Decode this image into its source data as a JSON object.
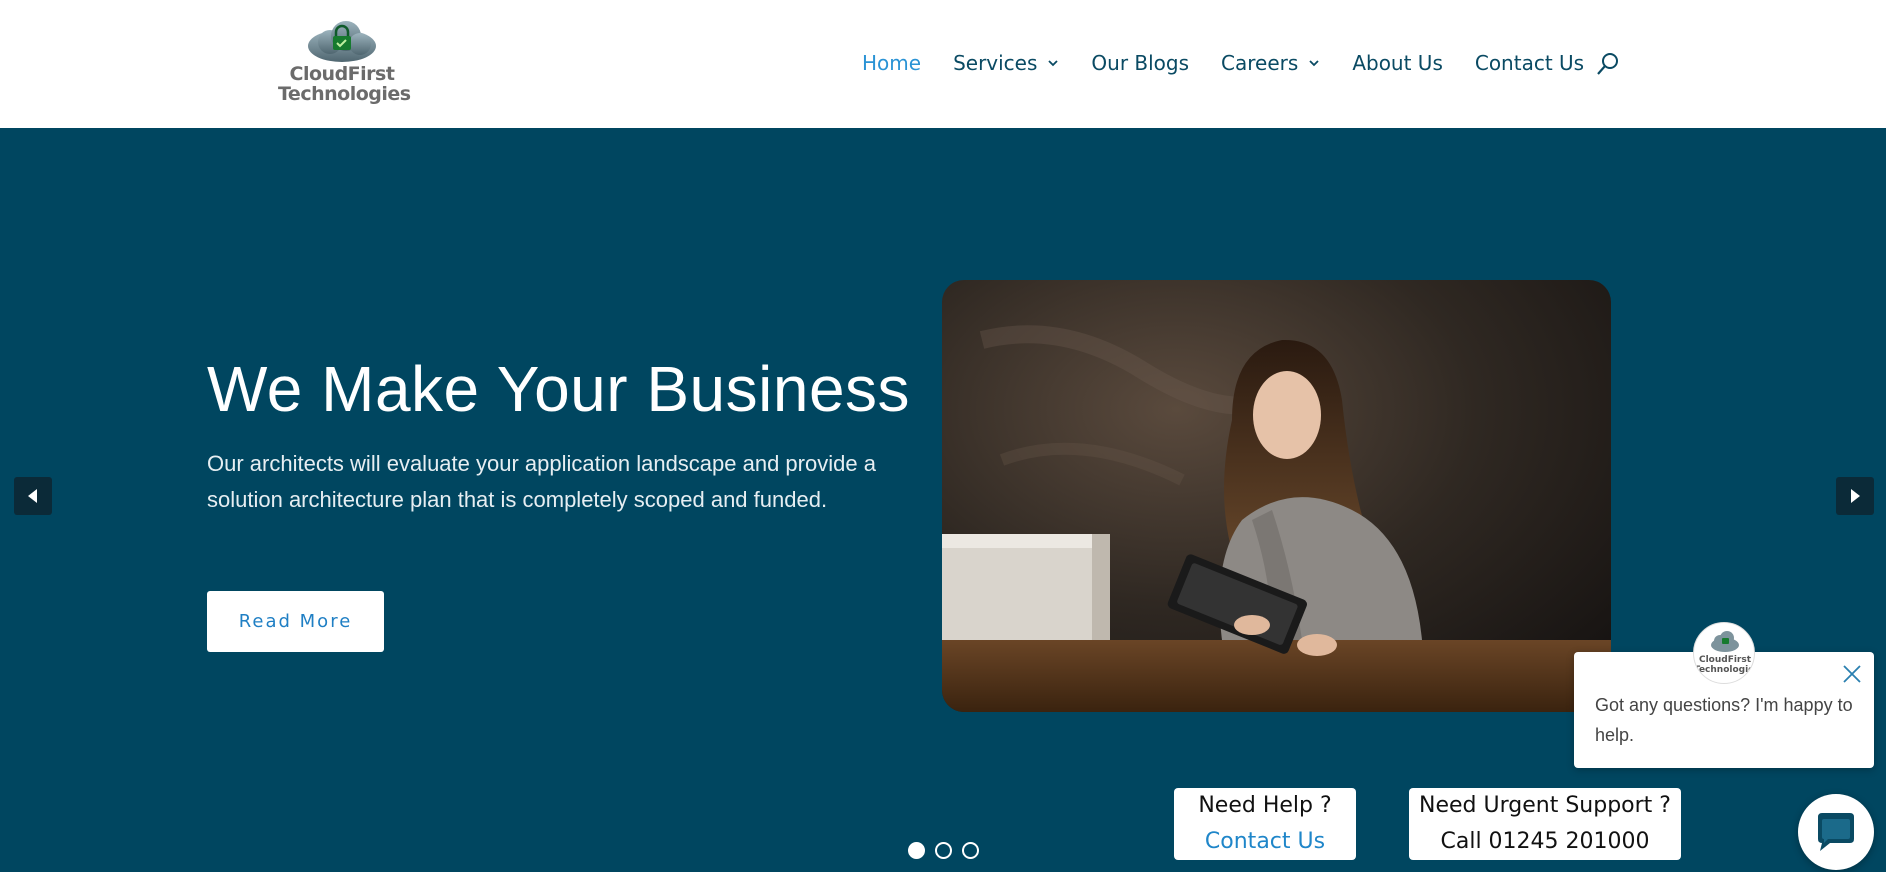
{
  "logo": {
    "line1": "CloudFirst",
    "line2": "Technologies"
  },
  "nav": {
    "items": [
      {
        "label": "Home",
        "active": true,
        "dropdown": false
      },
      {
        "label": "Services",
        "active": false,
        "dropdown": true
      },
      {
        "label": "Our Blogs",
        "active": false,
        "dropdown": false
      },
      {
        "label": "Careers",
        "active": false,
        "dropdown": true
      },
      {
        "label": "About Us",
        "active": false,
        "dropdown": false
      },
      {
        "label": "Contact Us",
        "active": false,
        "dropdown": false
      }
    ],
    "search_icon": "search-icon"
  },
  "hero": {
    "title": "We Make Your Business",
    "description": "Our architects will evaluate your application landscape and provide a solution architecture plan that is completely scoped and funded.",
    "button_label": "Read More",
    "image_alt": "woman-with-tablet-photo",
    "slide_count": 3,
    "active_slide": 1
  },
  "help": {
    "card1_title": "Need Help ?",
    "card1_link": "Contact Us",
    "card2_title": "Need Urgent Support ?",
    "card2_text": "Call 01245 201000"
  },
  "chat": {
    "message": "Got any questions? I'm happy to help.",
    "avatar_line1": "CloudFirst",
    "avatar_line2": "Technologies"
  },
  "colors": {
    "hero_bg": "#004660",
    "nav_text": "#0a4a63",
    "nav_active": "#2a93d5",
    "link": "#1f86c9"
  }
}
